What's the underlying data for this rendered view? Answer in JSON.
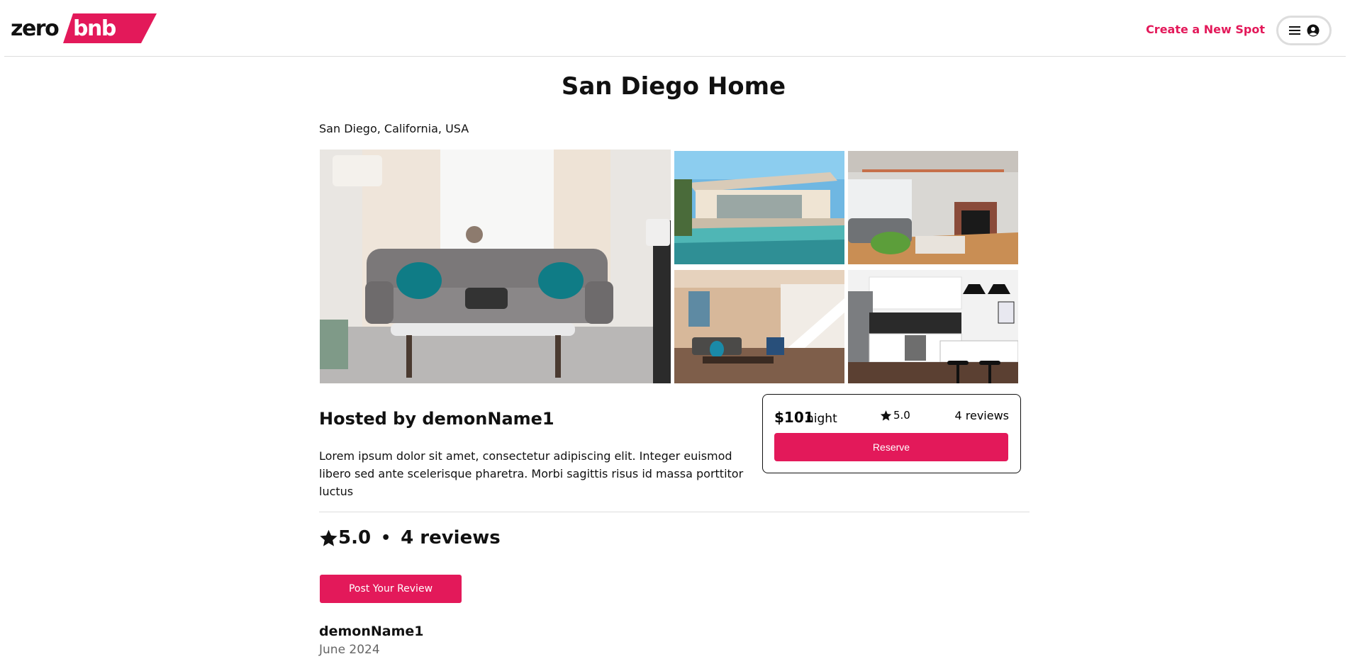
{
  "header": {
    "logo_left": "zero",
    "logo_right": "bnb",
    "create_link": "Create a New Spot",
    "brand_color": "#e3195a"
  },
  "spot": {
    "title": "San Diego Home",
    "location": "San Diego, California, USA",
    "host": "Hosted by demonName1",
    "description": "Lorem ipsum dolor sit amet, consectetur adipiscing elit. Integer euismod libero sed ante scelerisque pharetra. Morbi sagittis risus id massa porttitor luctus"
  },
  "gallery": {
    "images": [
      "living-room-sofa",
      "pool-house-exterior",
      "living-room-fireplace",
      "living-room-stairs",
      "kitchen"
    ]
  },
  "booking": {
    "price": "$101",
    "unit": "night",
    "rating": "5.0",
    "reviews": "4 reviews",
    "reserve_label": "Reserve"
  },
  "reviews_section": {
    "rating": "5.0",
    "separator": "•",
    "count": "4 reviews",
    "post_label": "Post Your Review",
    "items": [
      {
        "name": "demonName1",
        "date": "June 2024"
      }
    ]
  },
  "icons": {
    "menu": "hamburger-icon",
    "user": "user-circle-icon",
    "star": "star-icon"
  }
}
